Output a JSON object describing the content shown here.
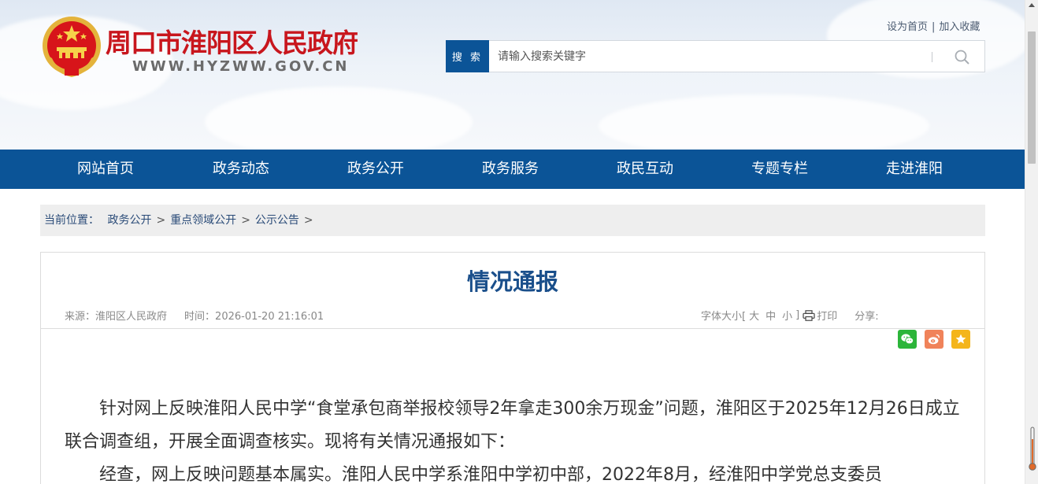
{
  "header": {
    "site_title": "周口市淮阳区人民政府",
    "site_domain": "WWW.HYZWW.GOV.CN",
    "top_links": [
      "设为首页",
      "加入收藏"
    ],
    "top_links_sep": "|",
    "search": {
      "button_label": "搜 索",
      "placeholder": "请输入搜索关键字"
    }
  },
  "nav": {
    "items": [
      "网站首页",
      "政务动态",
      "政务公开",
      "政务服务",
      "政民互动",
      "专题专栏",
      "走进淮阳"
    ]
  },
  "breadcrumb": {
    "prefix": "当前位置：",
    "items": [
      "政务公开",
      "重点领域公开",
      "公示公告"
    ],
    "arrow": ">"
  },
  "article": {
    "title": "情况通报",
    "source_label": "来源：",
    "source_value": "淮阳区人民政府",
    "time_label": "时间：",
    "time_value": "2026-01-20 21:16:01",
    "font_size_label": "字体大小[",
    "font_size_large": "大",
    "font_size_medium": "中",
    "font_size_small": "小",
    "font_size_close": "]",
    "print_label": "打印",
    "share_label": "分享:",
    "paragraphs": [
      "针对网上反映淮阳人民中学“食堂承包商举报校领导2年拿走300余万现金”问题，淮阳区于2025年12月26日成立联合调查组，开展全面调查核实。现将有关情况通报如下：",
      "经查，网上反映问题基本属实。淮阳人民中学系淮阳中学初中部，2022年8月，经淮阳中学党总支委员"
    ]
  },
  "colors": {
    "nav_bg": "#0b5497",
    "title_red": "#c8161d",
    "article_title": "#1a4f8b",
    "wechat": "#2cb53a",
    "weibo": "#f0835a",
    "favorite": "#f4b51b"
  },
  "icons": [
    "national-emblem-icon",
    "search-icon",
    "print-icon",
    "wechat-icon",
    "weibo-icon",
    "star-icon"
  ]
}
